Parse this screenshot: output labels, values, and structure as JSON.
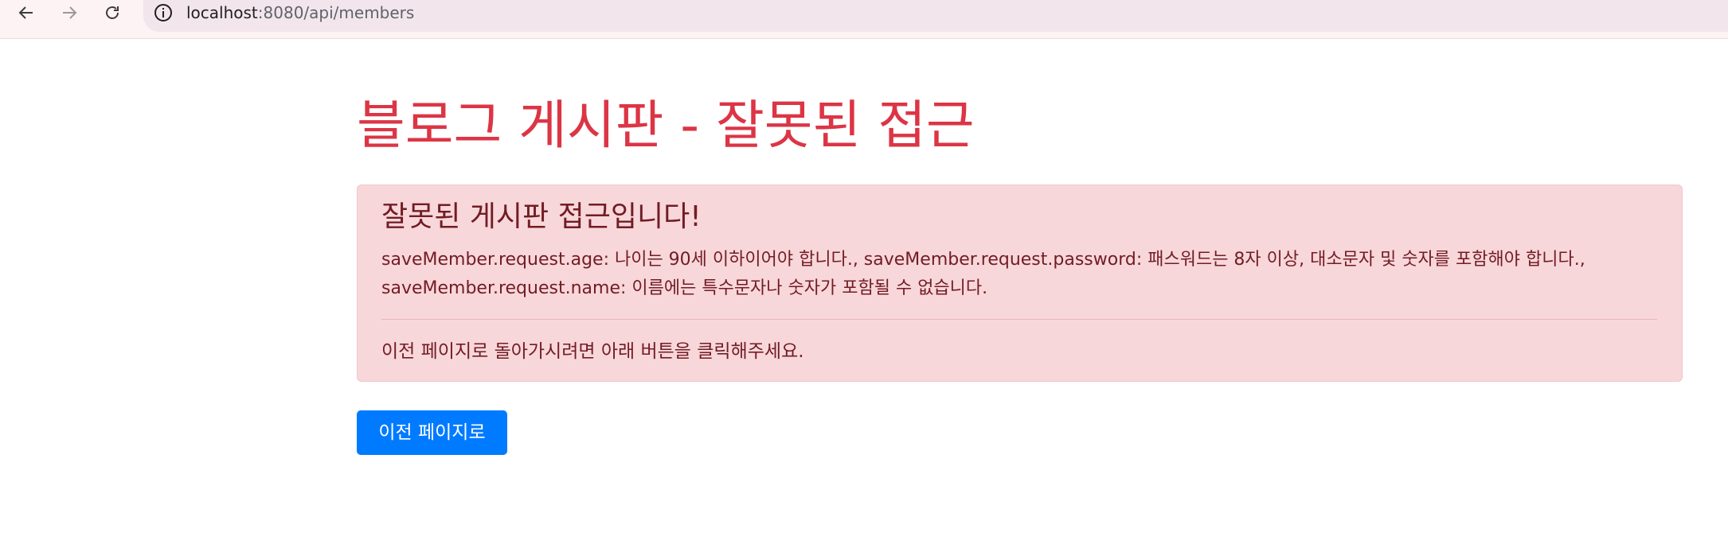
{
  "browser": {
    "url_host": "localhost",
    "url_rest": ":8080/api/members"
  },
  "page": {
    "title": "블로그 게시판 - 잘못된 접근"
  },
  "alert": {
    "heading": "잘못된 게시판 접근입니다!",
    "message": "saveMember.request.age: 나이는 90세 이하이어야 합니다., saveMember.request.password: 패스워드는 8자 이상, 대소문자 및 숫자를 포함해야 합니다., saveMember.request.name: 이름에는 특수문자나 숫자가 포함될 수 없습니다.",
    "instruction": "이전 페이지로 돌아가시려면 아래 버튼을 클릭해주세요."
  },
  "actions": {
    "back_label": "이전 페이지로"
  },
  "colors": {
    "danger": "#dc3545",
    "alert_bg": "#f8d7da",
    "alert_text": "#721c24",
    "primary": "#007bff"
  }
}
